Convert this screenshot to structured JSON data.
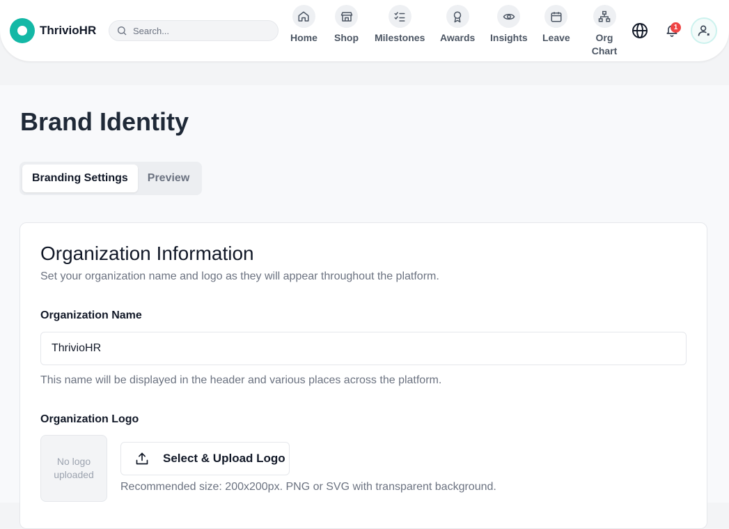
{
  "app": {
    "name": "ThrivioHR",
    "brand_color": "#14b8a6"
  },
  "search": {
    "placeholder": "Search..."
  },
  "nav": {
    "items": [
      {
        "label": "Home",
        "icon": "home-icon"
      },
      {
        "label": "Shop",
        "icon": "store-icon"
      },
      {
        "label": "Milestones",
        "icon": "checklist-icon"
      },
      {
        "label": "Awards",
        "icon": "award-icon"
      },
      {
        "label": "Insights",
        "icon": "eye-icon"
      },
      {
        "label": "Leave",
        "icon": "calendar-icon"
      },
      {
        "label": "Org Chart",
        "icon": "org-chart-icon"
      }
    ]
  },
  "header": {
    "language_icon": "globe-icon",
    "notifications": {
      "icon": "bell-icon",
      "count": "1",
      "badge_color": "#ef4444"
    },
    "avatar_icon": "user-icon"
  },
  "page": {
    "title": "Brand Identity",
    "tabs": [
      {
        "label": "Branding Settings",
        "active": true
      },
      {
        "label": "Preview",
        "active": false
      }
    ]
  },
  "card": {
    "title": "Organization Information",
    "description": "Set your organization name and logo as they will appear throughout the platform.",
    "name_field": {
      "label": "Organization Name",
      "value": "ThrivioHR",
      "help": "This name will be displayed in the header and various places across the platform."
    },
    "logo_field": {
      "label": "Organization Logo",
      "placeholder_text": "No logo uploaded",
      "upload_button": "Select & Upload Logo",
      "upload_icon": "upload-icon",
      "help": "Recommended size: 200x200px. PNG or SVG with transparent background."
    }
  }
}
